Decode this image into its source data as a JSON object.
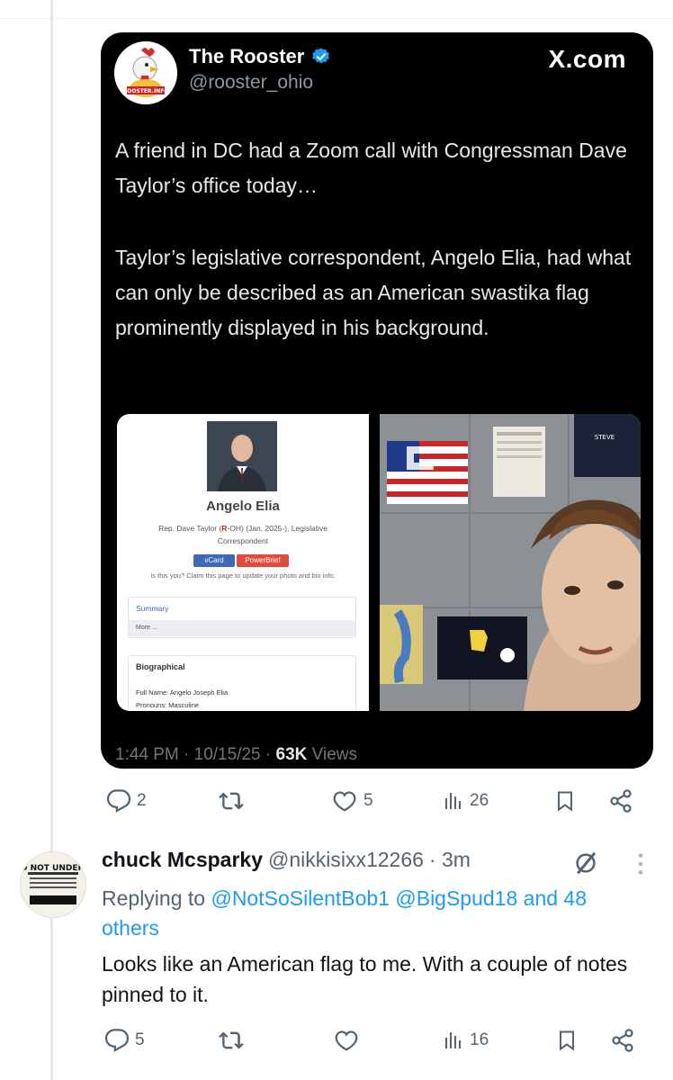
{
  "quoted": {
    "name": "The Rooster",
    "handle": "@rooster_ohio",
    "brand": "X.com",
    "avatar_text": "ROOSTER.INFO",
    "paragraph1": "A friend in DC had a Zoom call with Congressman Dave Taylor’s office today…",
    "paragraph2": "Taylor’s legislative correspondent, Angelo Elia, had what can only be described as an American swastika flag prominently displayed in his background.",
    "time": "1:44 PM · 10/15/25 · ",
    "views_count": "63K",
    "views_label": " Views",
    "profile": {
      "name": "Angelo Elia",
      "role_prefix": "Rep. Dave Taylor (",
      "role_party": "R",
      "role_suffix": "-OH) (Jan. 2025-), Legislative Correspondent",
      "vcard": "vCard",
      "powerbrief": "PowerBrief",
      "claim": "Is this you? Claim this page to update your photo and bio info.",
      "summary": "Summary",
      "more": "More ...",
      "biographical": "Biographical",
      "full_name": "Full Name: Angelo Joseph Elia",
      "pronouns": "Pronouns: Masculine"
    },
    "photo_sign": "STEVE"
  },
  "quoted_actions": {
    "replies": "2",
    "reposts": "",
    "likes": "5",
    "views": "26"
  },
  "reply": {
    "name": "chuck Mcsparky",
    "handle": "@nikkisixx12266",
    "time": "· 3m",
    "avatar_text": "MICE DIE IN MOUSE TRAPS BECAUSE THEY DO NOT UNDERSTAND WHY THE CHEESE IS FREE SOCIALISM",
    "replying_prefix": "Replying to ",
    "replying_to": "@NotSoSilentBob1 @BigSpud18 and 48 others",
    "text": "Looks like an American flag to me. With a couple of notes pinned to it."
  },
  "reply_actions": {
    "replies": "5",
    "views": "16"
  },
  "colors": {
    "link": "#1d9bf0",
    "muted": "#536471",
    "card_bg": "#000000",
    "verified": "#1d9bf0"
  }
}
